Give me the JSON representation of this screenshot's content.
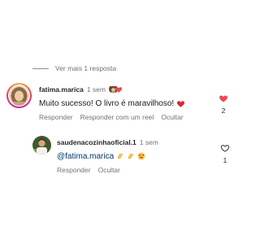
{
  "thread": {
    "view_more_replies": "Ver mais 1 resposta"
  },
  "comment": {
    "username": "fatima.marica",
    "time": "1 sem",
    "text": "Muito sucesso! O livro é maravilhoso!",
    "text_emoji": "heart-emoji",
    "actions": {
      "reply": "Responder",
      "reply_with_reel": "Responder com um reel",
      "hide": "Ocultar"
    },
    "like_count": "2",
    "liked": true,
    "like_color": "#ed4956",
    "liked_by_author_badge": "author-avatar-with-heart"
  },
  "reply": {
    "username": "saudenacozinhaoficial.1",
    "time": "1 sem",
    "mention": "@fatima.marica",
    "emojis": [
      "clapping-hands-emoji",
      "clapping-hands-emoji",
      "smiling-face-with-heart-eyes-emoji"
    ],
    "actions": {
      "reply": "Responder",
      "hide": "Ocultar"
    },
    "like_count": "1",
    "liked": false
  },
  "colors": {
    "secondary_text": "#737373",
    "primary_text": "#262626",
    "mention": "#00376b",
    "like_red": "#ed4956"
  }
}
